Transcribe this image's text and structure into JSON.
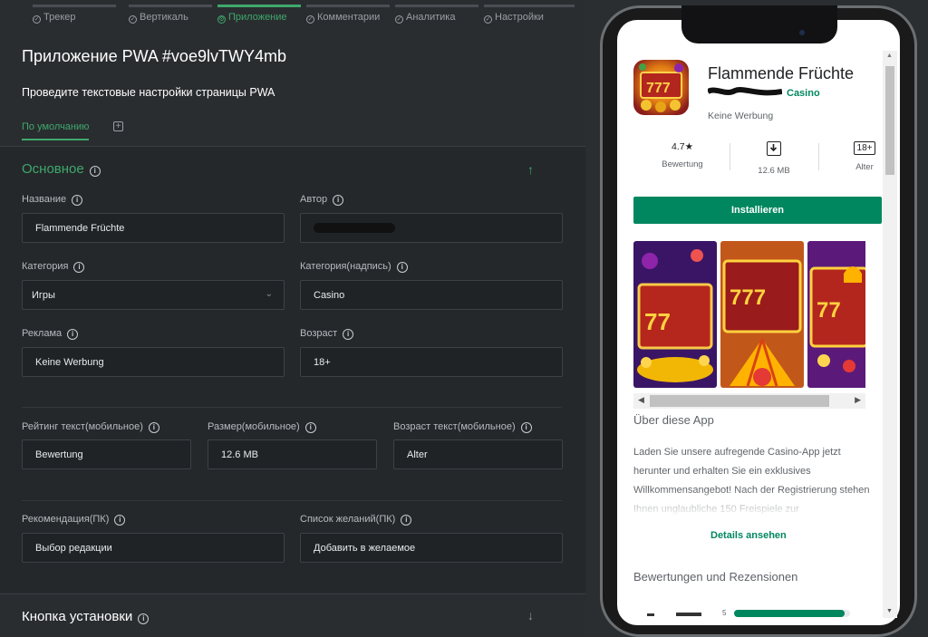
{
  "tabs": [
    {
      "label": "Трекер",
      "icon": "check-circle-icon",
      "active": false
    },
    {
      "label": "Вертикаль",
      "icon": "check-circle-icon",
      "active": false
    },
    {
      "label": "Приложение",
      "icon": "gear-circle-icon",
      "active": true
    },
    {
      "label": "Комментарии",
      "icon": "check-circle-icon",
      "active": false
    },
    {
      "label": "Аналитика",
      "icon": "check-circle-icon",
      "active": false
    },
    {
      "label": "Настройки",
      "icon": "check-circle-icon",
      "active": false
    }
  ],
  "page": {
    "title": "Приложение PWA #voe9lvTWY4mb",
    "subtitle": "Проведите текстовые настройки страницы PWA",
    "subtab": "По умолчанию",
    "subtab_add": "+"
  },
  "section_main": {
    "title": "Основное",
    "fields": {
      "name": {
        "label": "Название",
        "value": "Flammende Früchte"
      },
      "author": {
        "label": "Автор",
        "value": ""
      },
      "category": {
        "label": "Категория",
        "value": "Игры"
      },
      "category_caption": {
        "label": "Категория(надпись)",
        "value": "Casino"
      },
      "ads": {
        "label": "Реклама",
        "value": "Keine Werbung"
      },
      "age": {
        "label": "Возраст",
        "value": "18+"
      },
      "rating_text": {
        "label": "Рейтинг текст(мобильное)",
        "value": "Bewertung"
      },
      "size": {
        "label": "Размер(мобильное)",
        "value": "12.6 MB"
      },
      "age_text": {
        "label": "Возраст текст(мобильное)",
        "value": "Alter"
      },
      "recommendation": {
        "label": "Рекомендация(ПК)",
        "value": "Выбор редакции"
      },
      "wishlist": {
        "label": "Список желаний(ПК)",
        "value": "Добавить в желаемое"
      }
    }
  },
  "section_install": {
    "title": "Кнопка установки"
  },
  "preview": {
    "app_name": "Flammende Früchte",
    "category": "Casino",
    "ads": "Keine Werbung",
    "rating": "4.7★",
    "rating_label": "Bewertung",
    "size": "12.6 MB",
    "age": "18+",
    "age_label": "Alter",
    "install_label": "Installieren",
    "about_title": "Über diese App",
    "about_text": "Laden Sie unsere aufregende Casino-App jetzt herunter und erhalten Sie ein exklusives Willkommensangebot! Nach der Registrierung stehen Ihnen unglaubliche 150 Freispiele zur",
    "details_label": "Details ansehen",
    "reviews_title": "Bewertungen und Rezensionen",
    "review_row_star": "5",
    "review_row_fraction": 0.95
  },
  "colors": {
    "accent": "#3ea86c",
    "play_green": "#01875f",
    "panel_bg": "#2a2d30"
  }
}
